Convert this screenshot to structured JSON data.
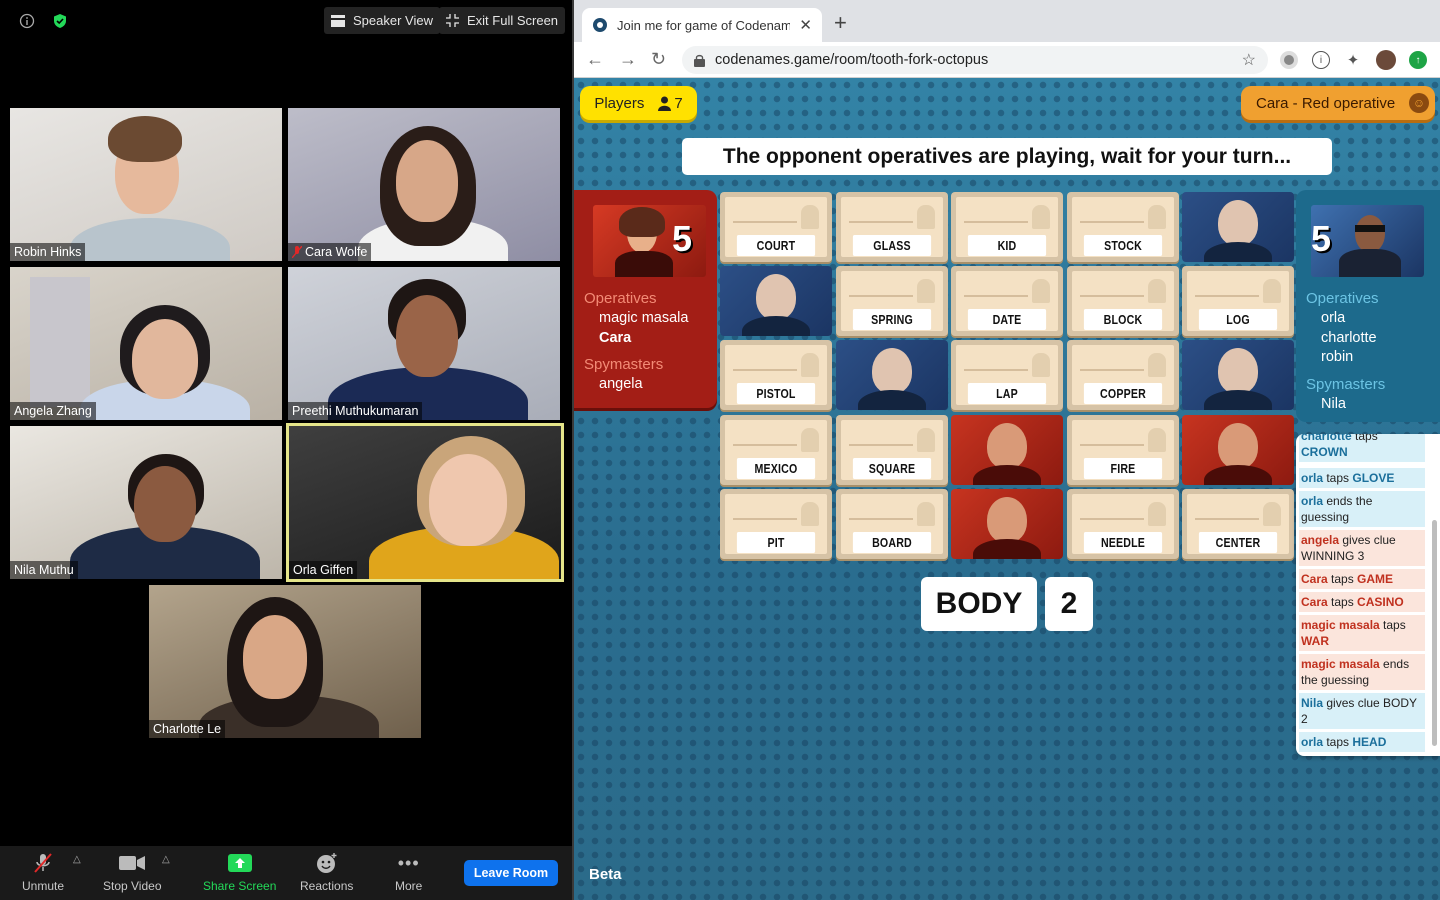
{
  "zoom": {
    "speaker_view": "Speaker View",
    "exit_full_screen": "Exit Full Screen",
    "participants": [
      {
        "name": "Robin Hinks"
      },
      {
        "name": "Cara Wolfe"
      },
      {
        "name": "Angela Zhang"
      },
      {
        "name": "Preethi Muthukumaran"
      },
      {
        "name": "Nila Muthu"
      },
      {
        "name": "Orla Giffen"
      },
      {
        "name": "Charlotte Le"
      }
    ],
    "toolbar": {
      "unmute": "Unmute",
      "stop_video": "Stop Video",
      "share_screen": "Share Screen",
      "reactions": "Reactions",
      "more": "More",
      "leave": "Leave Room"
    },
    "colors": {
      "share_green": "#23d959",
      "leave_blue": "#0e72ed",
      "active_speaker": "#e5e58a"
    }
  },
  "browser": {
    "tab_title": "Join me for game of Codenames",
    "url": "codenames.game/room/tooth-fork-octopus"
  },
  "game": {
    "players_label": "Players",
    "players_count": "7",
    "role": "Cara - Red operative",
    "banner": "The opponent operatives are playing, wait for your turn...",
    "red_team": {
      "score": "5",
      "operatives_label": "Operatives",
      "operatives": [
        "magic masala",
        "Cara"
      ],
      "spymasters_label": "Spymasters",
      "spymasters": [
        "angela"
      ]
    },
    "blue_team": {
      "score": "5",
      "operatives_label": "Operatives",
      "operatives": [
        "orla",
        "charlotte",
        "robin"
      ],
      "spymasters_label": "Spymasters",
      "spymasters": [
        "Nila"
      ]
    },
    "cards": [
      {
        "word": "COURT"
      },
      {
        "word": "GLASS"
      },
      {
        "word": "KID"
      },
      {
        "word": "STOCK"
      },
      {
        "agent": "blue"
      },
      {
        "agent": "blue"
      },
      {
        "word": "SPRING"
      },
      {
        "word": "DATE"
      },
      {
        "word": "BLOCK"
      },
      {
        "word": "LOG"
      },
      {
        "word": "PISTOL"
      },
      {
        "agent": "blue"
      },
      {
        "word": "LAP"
      },
      {
        "word": "COPPER"
      },
      {
        "agent": "blue"
      },
      {
        "word": "MEXICO"
      },
      {
        "word": "SQUARE"
      },
      {
        "agent": "red"
      },
      {
        "word": "FIRE"
      },
      {
        "agent": "red"
      },
      {
        "word": "PIT"
      },
      {
        "word": "BOARD"
      },
      {
        "agent": "red"
      },
      {
        "word": "NEEDLE"
      },
      {
        "word": "CENTER"
      }
    ],
    "clue_word": "BODY",
    "clue_number": "2",
    "beta": "Beta",
    "log": [
      {
        "team": "b",
        "actor": "charlotte",
        "action": " taps ",
        "word": "CROWN"
      },
      {
        "team": "b",
        "actor": "orla",
        "action": " taps ",
        "word": "GLOVE"
      },
      {
        "team": "b",
        "actor": "orla",
        "action": " ends the guessing",
        "word": ""
      },
      {
        "team": "r",
        "actor": "angela",
        "action": " gives clue WINNING 3",
        "word": ""
      },
      {
        "team": "r",
        "actor": "Cara",
        "action": " taps ",
        "word": "GAME"
      },
      {
        "team": "r",
        "actor": "Cara",
        "action": " taps ",
        "word": "CASINO"
      },
      {
        "team": "r",
        "actor": "magic masala",
        "action": " taps ",
        "word": "WAR"
      },
      {
        "team": "r",
        "actor": "magic masala",
        "action": " ends the guessing",
        "word": ""
      },
      {
        "team": "b",
        "actor": "Nila",
        "action": " gives clue BODY 2",
        "word": ""
      },
      {
        "team": "b",
        "actor": "orla",
        "action": " taps ",
        "word": "HEAD"
      }
    ],
    "colors": {
      "red": "#a31e16",
      "blue": "#1d6a8c",
      "players_yellow": "#ffe100",
      "role_orange": "#f0a030"
    }
  }
}
